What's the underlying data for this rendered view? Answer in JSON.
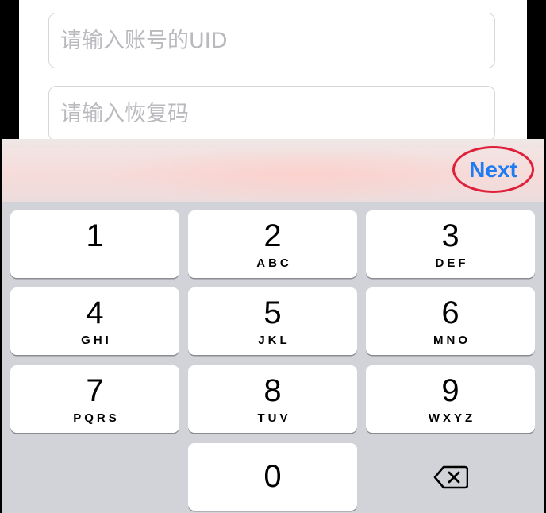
{
  "form": {
    "uid_placeholder": "请输入账号的UID",
    "code_placeholder": "请输入恢复码"
  },
  "toolbar": {
    "next_label": "Next"
  },
  "keypad": {
    "keys": [
      {
        "digit": "1",
        "letters": ""
      },
      {
        "digit": "2",
        "letters": "ABC"
      },
      {
        "digit": "3",
        "letters": "DEF"
      },
      {
        "digit": "4",
        "letters": "GHI"
      },
      {
        "digit": "5",
        "letters": "JKL"
      },
      {
        "digit": "6",
        "letters": "MNO"
      },
      {
        "digit": "7",
        "letters": "PQRS"
      },
      {
        "digit": "8",
        "letters": "TUV"
      },
      {
        "digit": "9",
        "letters": "WXYZ"
      },
      {
        "digit": "0",
        "letters": ""
      }
    ],
    "backspace_icon": "delete-left-icon"
  },
  "colors": {
    "accent": "#1f7bf2",
    "highlight_ring": "#e0203a",
    "keyboard_bg": "#d1d3d9",
    "key_bg": "#ffffff",
    "placeholder": "#b9b9be"
  }
}
